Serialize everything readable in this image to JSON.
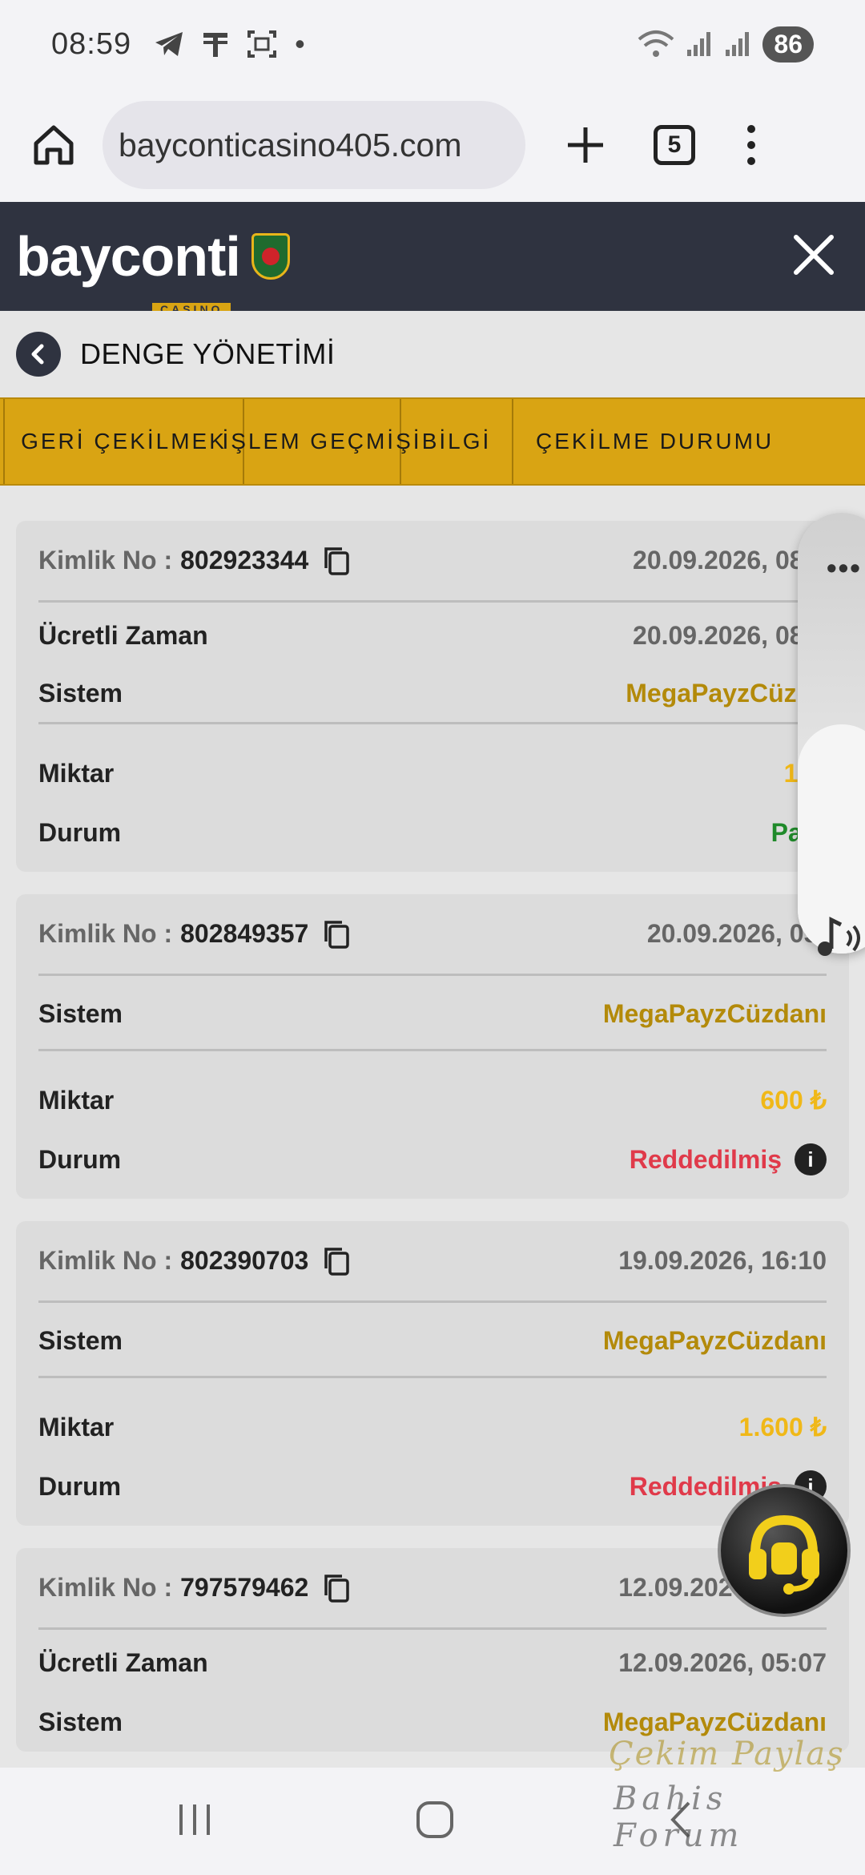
{
  "status_bar": {
    "time": "08:59",
    "dot": "•",
    "battery": "86",
    "icons": [
      "telegram-icon",
      "message-icon",
      "screenshot-icon",
      "wifi-icon",
      "signal-icon",
      "signal-icon"
    ]
  },
  "browser": {
    "url": "bayconticasino405.com",
    "tab_count": "5",
    "icons": [
      "home-icon",
      "plus-icon",
      "tabs-icon",
      "more-icon"
    ]
  },
  "site": {
    "logo_text": "bayconti",
    "logo_sub": "CASINO",
    "close_icon": "close-icon"
  },
  "page": {
    "title": "DENGE YÖNETİMİ"
  },
  "tabs": [
    {
      "label": "GERİ ÇEKİLMEK"
    },
    {
      "label": "İŞLEM GEÇMİŞİ"
    },
    {
      "label": "BİLGİ"
    },
    {
      "label": "ÇEKİLME DURUMU"
    }
  ],
  "labels": {
    "id": "Kimlik No :",
    "paid_time": "Ücretli Zaman",
    "system": "Sistem",
    "amount": "Miktar",
    "status": "Durum",
    "info": "i"
  },
  "transactions": [
    {
      "id": "802923344",
      "date": "20.09.2026, 08:5",
      "paid_time": "20.09.2026, 08:5",
      "system": "MegaPayzCüzda",
      "amount": "170",
      "status": "Para"
    },
    {
      "id": "802849357",
      "date": "20.09.2026, 05:",
      "system": "MegaPayzCüzdanı",
      "amount": "600 ₺",
      "status": "Reddedilmiş"
    },
    {
      "id": "802390703",
      "date": "19.09.2026, 16:10",
      "system": "MegaPayzCüzdanı",
      "amount": "1.600 ₺",
      "status": "Reddedilmiş"
    },
    {
      "id": "797579462",
      "date": "12.09.2026, 05:07",
      "paid_time": "12.09.2026, 05:07",
      "system": "MegaPayzCüzdanı"
    }
  ],
  "floating": {
    "more": "•••",
    "support_icon": "headset-icon",
    "music_icon": "music-icon"
  },
  "watermark": {
    "line1": "Çekim Paylaş",
    "line2": "Bahis Forum"
  },
  "colors": {
    "header": "#2f3340",
    "accent": "#d9a413",
    "amount": "#f0b818",
    "success": "#1f8a2a",
    "rejected": "#e03a4a"
  }
}
